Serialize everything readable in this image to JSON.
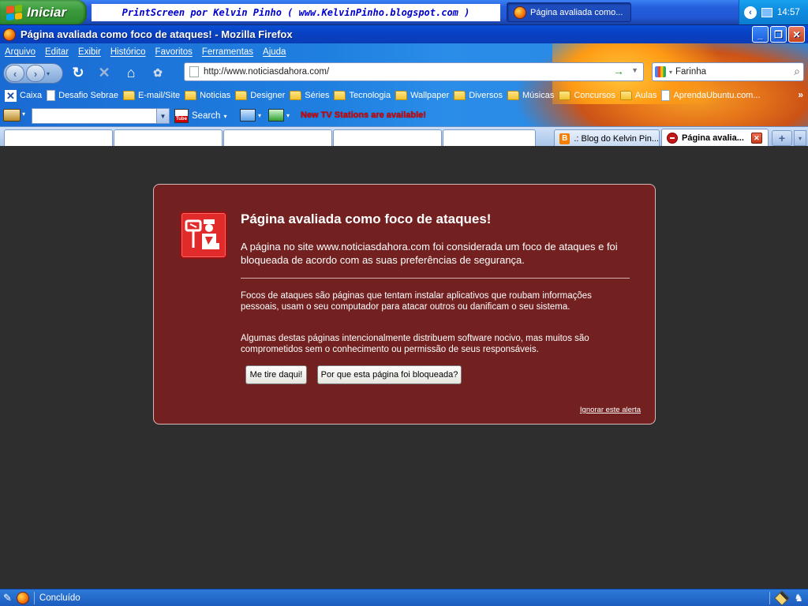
{
  "taskbar": {
    "start_label": "Iniciar",
    "banner_text": "PrintScreen por Kelvin Pinho ( www.KelvinPinho.blogspot.com )",
    "task_label": "Página avaliada como...",
    "clock": "14:57"
  },
  "window": {
    "title": "Página avaliada como foco de ataques! - Mozilla Firefox"
  },
  "menu": {
    "items": [
      "Arquivo",
      "Editar",
      "Exibir",
      "Histórico",
      "Favoritos",
      "Ferramentas",
      "Ajuda"
    ]
  },
  "navbar": {
    "url": "http://www.noticiasdahora.com/",
    "search_value": "Farinha"
  },
  "bookmarks": {
    "items": [
      "Caixa",
      "Desafio Sebrae",
      "E-mail/Site",
      "Noticias",
      "Designer",
      "Séries",
      "Tecnologia",
      "Wallpaper",
      "Diversos",
      "Músicas",
      "Concursos",
      "Aulas",
      "AprendaUbuntu.com..."
    ],
    "overflow": "»"
  },
  "toolbar3": {
    "search_label": "Search",
    "youtube_top": "You",
    "youtube_bottom": "Tube",
    "tv_message": "New TV Stations are available!"
  },
  "tabs": {
    "blog_label": ".: Blog do Kelvin Pin...",
    "blog_icon_letter": "B",
    "active_label": "Página avalia...",
    "new_tab": "+",
    "list_tabs": "▾"
  },
  "warning": {
    "title": "Página avaliada como foco de ataques!",
    "lead": "A página no site www.noticiasdahora.com foi considerada um foco de ataques e foi bloqueada de acordo com as suas preferências de segurança.",
    "desc1": "Focos de ataques são páginas que tentam instalar aplicativos que roubam informações pessoais, usam o seu computador para atacar outros ou danificam o seu sistema.",
    "desc2": "Algumas destas páginas intencionalmente distribuem software nocivo, mas muitos são comprometidos sem o conhecimento ou permissão de seus responsáveis.",
    "btn_leave": "Me tire daqui!",
    "btn_why": "Por que esta página foi bloqueada?",
    "ignore_link": "Ignorar este alerta"
  },
  "statusbar": {
    "text": "Concluído"
  },
  "colors": {
    "panel_bg": "#722020",
    "page_bg": "#2e2e2e",
    "xp_blue": "#245edb",
    "start_green": "#3c9a3c"
  }
}
